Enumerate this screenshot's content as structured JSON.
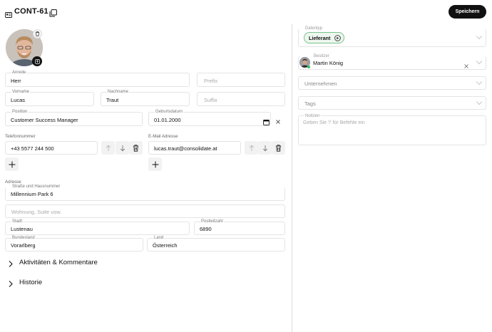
{
  "header": {
    "record_id": "CONT-61",
    "save_label": "Speichern"
  },
  "contact": {
    "salutation": {
      "label": "Anrede",
      "value": "Herr"
    },
    "prefix": {
      "placeholder": "Prefix"
    },
    "first_name": {
      "label": "Vorname",
      "value": "Lucas"
    },
    "last_name": {
      "label": "Nachname",
      "value": "Traut"
    },
    "suffix": {
      "placeholder": "Suffix"
    },
    "position": {
      "label": "Position",
      "value": "Customer Success Manager"
    },
    "birthday": {
      "label": "Geburtsdatum",
      "value": "01.01.2000"
    },
    "phone": {
      "label": "Telefonnummer",
      "value": "+43 5577 244 500"
    },
    "email": {
      "label": "E-Mail Adresse",
      "value": "lucas.traut@consolidate.at"
    }
  },
  "address": {
    "section_label": "Adresse",
    "street": {
      "label": "Straße und Hausnummer",
      "value": "Millennium Park 6"
    },
    "apartment": {
      "placeholder": "Wohnung, Suite usw."
    },
    "city": {
      "label": "Stadt",
      "value": "Lustenau"
    },
    "zip": {
      "label": "Postleitzahl",
      "value": "6890"
    },
    "state": {
      "label": "Bundesland",
      "value": "Vorarlberg"
    },
    "country": {
      "label": "Land",
      "value": "Österreich"
    }
  },
  "sections": {
    "activities": "Aktivitäten & Kommentare",
    "history": "Historie"
  },
  "side": {
    "datatype": {
      "label": "Datentyp",
      "value": "Lieferant",
      "color": "#78c28a"
    },
    "owner": {
      "label": "Besitzer",
      "value": "Martin König"
    },
    "company": {
      "placeholder": "Unternehmen"
    },
    "tags": {
      "placeholder": "Tags"
    },
    "notes": {
      "label": "Notizen",
      "placeholder": "Geben Sie '/' für Befehle ein"
    }
  },
  "icons": [
    "contact-card-icon",
    "copy-icon",
    "trash-icon",
    "upload-icon",
    "calendar-icon",
    "clear-icon",
    "arrow-up-icon",
    "arrow-down-icon",
    "plus-icon",
    "chevron-right-icon",
    "chevron-down-icon",
    "play-circle-icon"
  ]
}
